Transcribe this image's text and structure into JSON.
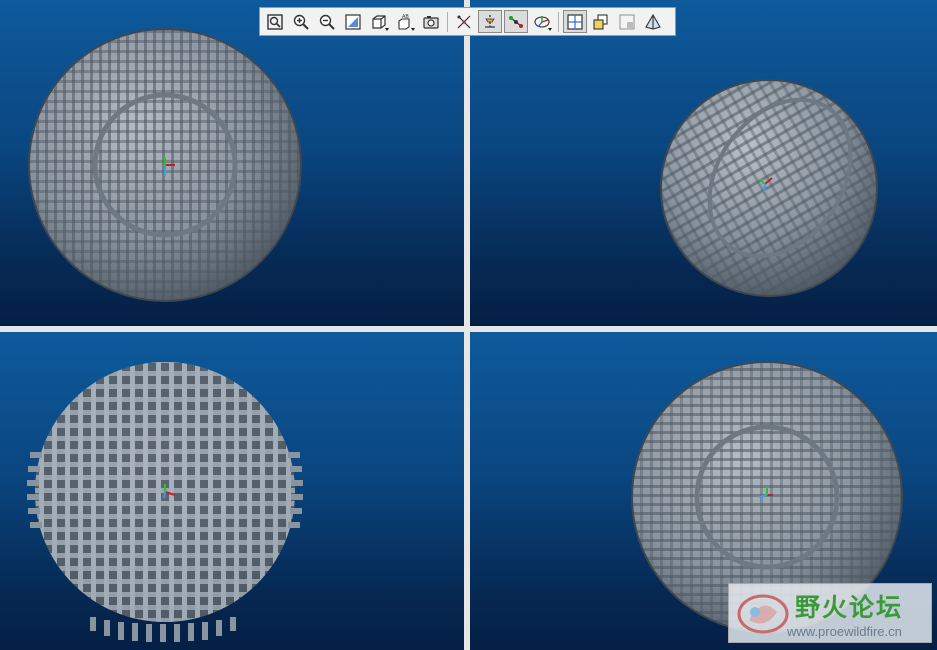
{
  "toolbar": {
    "buttons": [
      {
        "icon": "refit-icon",
        "label": "Refit",
        "active": false,
        "dropdown": false
      },
      {
        "icon": "zoom-in-icon",
        "label": "Zoom In",
        "active": false,
        "dropdown": false
      },
      {
        "icon": "zoom-out-icon",
        "label": "Zoom Out",
        "active": false,
        "dropdown": false
      },
      {
        "icon": "repaint-icon",
        "label": "Repaint",
        "active": false,
        "dropdown": false
      },
      {
        "icon": "display-style-icon",
        "label": "Display Style",
        "active": false,
        "dropdown": true
      },
      {
        "icon": "saved-views-icon",
        "label": "Saved Views",
        "active": false,
        "dropdown": true
      },
      {
        "icon": "view-manager-icon",
        "label": "View Manager",
        "active": false,
        "dropdown": false
      },
      {
        "icon": "datum-planes-icon",
        "label": "Datum Planes",
        "active": false,
        "dropdown": false
      },
      {
        "icon": "datum-axes-icon",
        "label": "Datum Axes",
        "active": true,
        "dropdown": false
      },
      {
        "icon": "datum-points-icon",
        "label": "Datum Points",
        "active": true,
        "dropdown": false
      },
      {
        "icon": "csys-icon",
        "label": "Coordinate Systems",
        "active": false,
        "dropdown": true
      },
      {
        "icon": "layout-quad-icon",
        "label": "Multiple Views",
        "active": true,
        "dropdown": false
      },
      {
        "icon": "spin-center-icon",
        "label": "Spin Center",
        "active": false,
        "dropdown": false
      },
      {
        "icon": "annotation-icon",
        "label": "Annotations",
        "active": false,
        "dropdown": false
      },
      {
        "icon": "perspective-icon",
        "label": "Perspective",
        "active": false,
        "dropdown": false
      }
    ]
  },
  "viewports": [
    {
      "id": "top-left",
      "pattern": "vertical-rings"
    },
    {
      "id": "top-right",
      "pattern": "isometric"
    },
    {
      "id": "bottom-left",
      "pattern": "grid-spikes"
    },
    {
      "id": "bottom-right",
      "pattern": "horizontal-rings"
    }
  ],
  "colors": {
    "background_top": "#0e5a9c",
    "background_bottom": "#041f44",
    "model": "#8a949e",
    "axis_x": "#c0202c",
    "axis_y": "#22c822",
    "axis_z": "#3aa0e0"
  },
  "watermark": {
    "title": "野火论坛",
    "url": "www.proewildfire.cn"
  }
}
